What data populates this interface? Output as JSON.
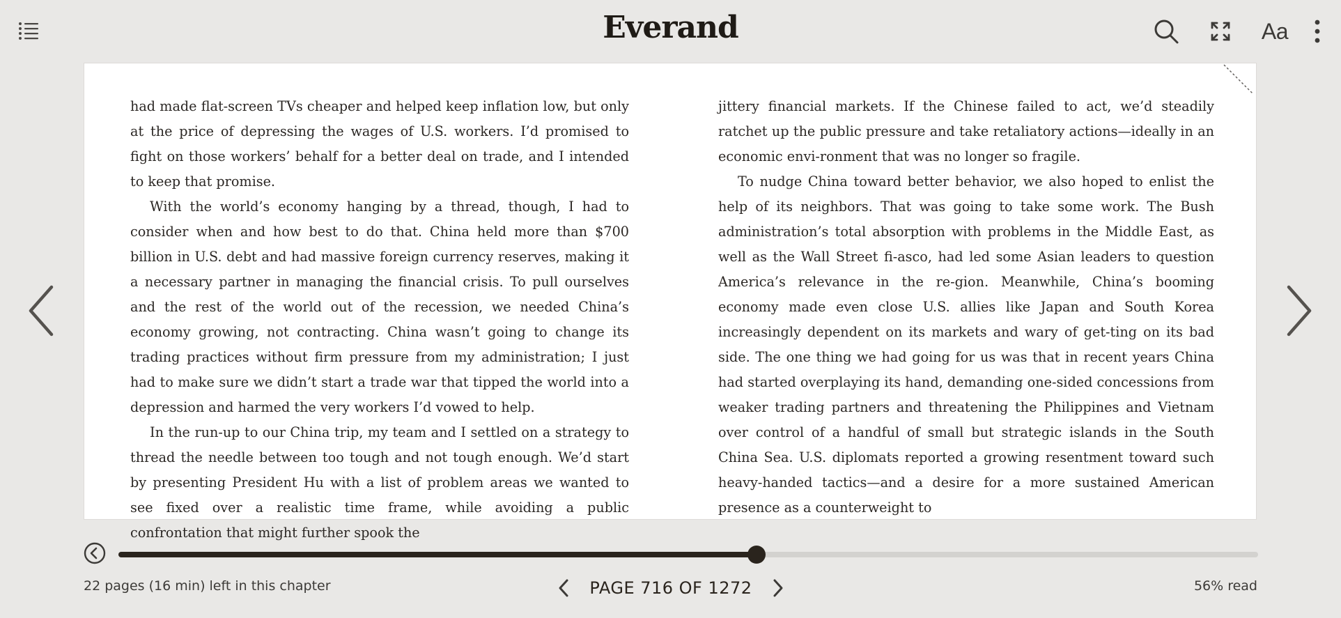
{
  "header": {
    "brand": "Everand",
    "icons": [
      "list-icon",
      "search-icon",
      "fullscreen-icon",
      "font-settings-icon",
      "more-vertical-icon"
    ],
    "font_settings_label": "Aa"
  },
  "page": {
    "left_column": [
      "had made flat-screen TVs cheaper and helped keep inflation low, but only at the price of depressing the wages of U.S. workers. I’d promised to fight on those workers’ behalf for a better deal on trade, and I intended to keep that promise.",
      "With the world’s economy hanging by a thread, though, I had to consider when and how best to do that. China held more than $700 billion in U.S. debt and had massive foreign currency reserves, making it a necessary partner in managing the financial crisis. To pull ourselves and the rest of the world out of the recession, we needed China’s economy growing, not contracting. China wasn’t going to change its trading practices without firm pressure from my administration; I just had to make sure we didn’t start a trade war that tipped the world into a depression and harmed the very workers I’d vowed to help.",
      "In the run-up to our China trip, my team and I settled on a strategy to thread the needle between too tough and not tough enough. We’d start by presenting President Hu with a list of problem areas we wanted to see fixed over a realistic time frame, while avoiding a public confrontation that might further spook the"
    ],
    "right_column": [
      "jittery financial markets. If the Chinese failed to act, we’d steadily ratchet up the public pressure and take retaliatory actions—ideally in an economic envi-ronment that was no longer so fragile.",
      "To nudge China toward better behavior, we also hoped to enlist the help of its neighbors. That was going to take some work. The Bush administration’s total absorption with problems in the Middle East, as well as the Wall Street fi-asco, had led some Asian leaders to question America’s relevance in the re-gion. Meanwhile, China’s booming economy made even close U.S. allies like Japan and South Korea increasingly dependent on its markets and wary of get-ting on its bad side. The one thing we had going for us was that in recent years China had started overplaying its hand, demanding one-sided concessions from weaker trading partners and threatening the Philippines and Vietnam over control of a handful of small but strategic islands in the South China Sea. U.S. diplomats reported a growing resentment toward such heavy-handed tactics—and a desire for a more sustained American presence as a counterweight to"
    ]
  },
  "navigation": {
    "prev_icon": "chevron-left-icon",
    "next_icon": "chevron-right-icon"
  },
  "progress": {
    "fraction": 0.56,
    "back_icon": "back-circle-icon"
  },
  "footer": {
    "chapter_remaining": "22 pages (16 min) left in this chapter",
    "page_label": "PAGE 716 OF 1272",
    "read_percent": "56% read"
  },
  "colors": {
    "background": "#e9e8e6",
    "page": "#ffffff",
    "accent": "#2a241d",
    "track": "#d3d2cf"
  }
}
